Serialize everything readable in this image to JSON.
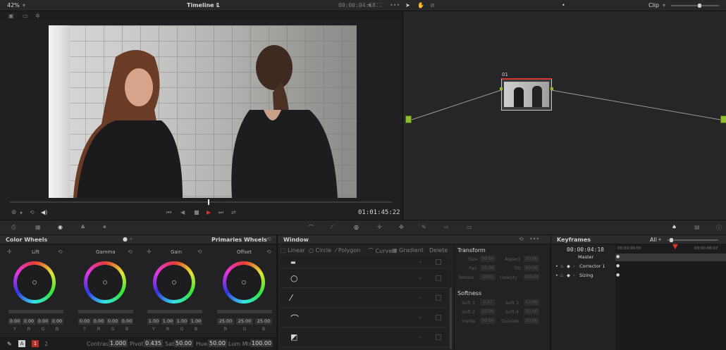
{
  "viewer": {
    "zoom": "42%",
    "timeline_title": "Timeline 1",
    "timecode_top": "00:00:04:18",
    "timecode_bottom": "01:01:45:22"
  },
  "node_editor": {
    "mode": "Clip",
    "node_label": "01"
  },
  "color_wheels": {
    "title": "Color Wheels",
    "mode": "Primaries Wheels",
    "wheels": [
      {
        "name": "Lift",
        "values": [
          "0.00",
          "0.00",
          "0.00",
          "0.00"
        ]
      },
      {
        "name": "Gamma",
        "values": [
          "0.00",
          "0.00",
          "0.00",
          "0.00"
        ]
      },
      {
        "name": "Gain",
        "values": [
          "1.00",
          "1.00",
          "1.00",
          "1.00"
        ]
      },
      {
        "name": "Offset",
        "values": [
          "25.00",
          "25.00",
          "25.00"
        ]
      }
    ],
    "channels4": [
      "Y",
      "R",
      "G",
      "B"
    ],
    "channels3": [
      "R",
      "G",
      "B"
    ],
    "page_a": "1",
    "page_b": "2",
    "contrast_label": "Contrast",
    "contrast": "1.000",
    "pivot_label": "Pivot",
    "pivot": "0.435",
    "sat_label": "Sat",
    "sat": "50.00",
    "hue_label": "Hue",
    "hue": "50.00",
    "lummix_label": "Lum Mix",
    "lummix": "100.00"
  },
  "window": {
    "title": "Window",
    "tools": [
      "Linear",
      "Circle",
      "Polygon",
      "Curve",
      "Gradient"
    ],
    "delete_label": "Delete",
    "transform_title": "Transform",
    "transform_fields": [
      {
        "label": "Size",
        "value": "50.00"
      },
      {
        "label": "Aspect",
        "value": "50.00"
      },
      {
        "label": "Pan",
        "value": "50.00"
      },
      {
        "label": "Tilt",
        "value": "50.00"
      },
      {
        "label": "Rotate",
        "value": "0.00"
      },
      {
        "label": "Opacity",
        "value": "100.00"
      }
    ],
    "softness_title": "Softness",
    "softness_fields": [
      {
        "label": "Soft 1",
        "value": "2.07"
      },
      {
        "label": "Soft 3",
        "value": "50.00"
      },
      {
        "label": "Soft 2",
        "value": "50.00"
      },
      {
        "label": "Soft 4",
        "value": "50.00"
      },
      {
        "label": "Inside",
        "value": "50.00"
      },
      {
        "label": "Outside",
        "value": "50.00"
      }
    ]
  },
  "keyframes": {
    "title": "Keyframes",
    "filter": "All",
    "timecode": "00:00:04:18",
    "ruler_start": "00:00:00:00",
    "ruler_end": "00:00:06:07",
    "tracks": [
      "Master",
      "Corrector 1",
      "Sizing"
    ]
  },
  "colors": {
    "accent_red": "#d8352a",
    "node_green": "#9acd32"
  }
}
